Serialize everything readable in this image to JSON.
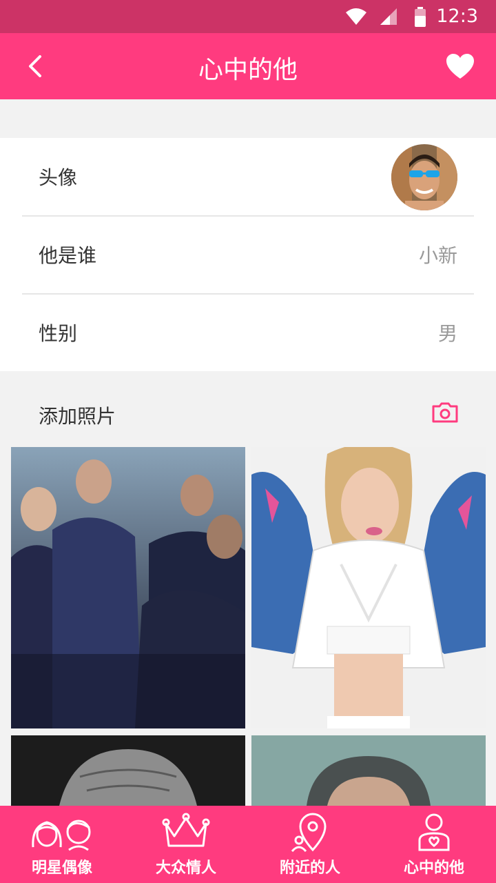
{
  "status_bar": {
    "time": "12:3"
  },
  "header": {
    "title": "心中的他"
  },
  "profile": {
    "avatar_label": "头像",
    "who_label": "他是谁",
    "who_value": "小新",
    "gender_label": "性别",
    "gender_value": "男"
  },
  "photos": {
    "add_label": "添加照片"
  },
  "tabs": [
    {
      "label": "明星偶像",
      "icon": "idol-couple-icon"
    },
    {
      "label": "大众情人",
      "icon": "crown-icon"
    },
    {
      "label": "附近的人",
      "icon": "location-person-icon"
    },
    {
      "label": "心中的他",
      "icon": "person-heart-icon"
    }
  ],
  "colors": {
    "primary": "#ff3b7f",
    "status_bar": "#cc3366",
    "background": "#f2f2f2"
  }
}
